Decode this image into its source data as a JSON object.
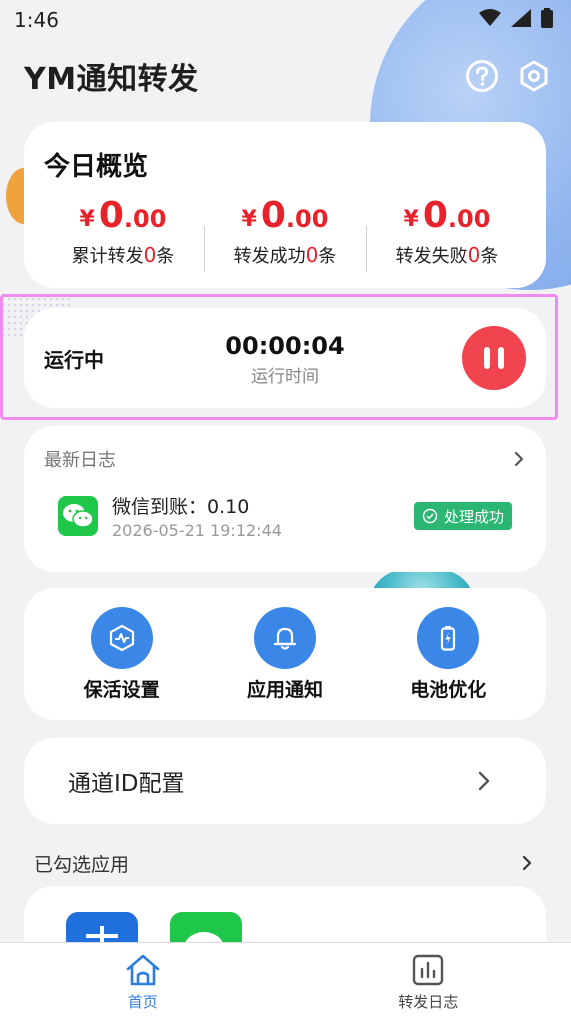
{
  "status_bar": {
    "time": "1:46"
  },
  "app": {
    "title": "YM通知转发"
  },
  "overview": {
    "title": "今日概览",
    "stats": [
      {
        "currency": "¥",
        "amount_int": "0",
        "amount_dec": ".00",
        "label_prefix": "累计转发",
        "count": "0",
        "label_suffix": "条"
      },
      {
        "currency": "¥",
        "amount_int": "0",
        "amount_dec": ".00",
        "label_prefix": "转发成功",
        "count": "0",
        "label_suffix": "条"
      },
      {
        "currency": "¥",
        "amount_int": "0",
        "amount_dec": ".00",
        "label_prefix": "转发失败",
        "count": "0",
        "label_suffix": "条"
      }
    ]
  },
  "run": {
    "status": "运行中",
    "elapsed": "00:00:04",
    "elapsed_label": "运行时间"
  },
  "log": {
    "title": "最新日志",
    "latest": {
      "message": "微信到账：0.10",
      "datetime": "2026-05-21 19:12:44",
      "badge": "处理成功"
    }
  },
  "quick_actions": [
    {
      "label": "保活设置",
      "icon": "shield-pulse-icon"
    },
    {
      "label": "应用通知",
      "icon": "bell-icon"
    },
    {
      "label": "电池优化",
      "icon": "battery-icon"
    }
  ],
  "channel": {
    "label": "通道ID配置"
  },
  "selected_apps": {
    "title": "已勾选应用"
  },
  "bottom_nav": [
    {
      "label": "首页",
      "icon": "home-icon",
      "active": true
    },
    {
      "label": "转发日志",
      "icon": "chart-icon",
      "active": false
    }
  ],
  "colors": {
    "accent_red": "#e8222b",
    "accent_blue": "#3a87e8",
    "success_green": "#2bb673",
    "highlight": "#f08cf0"
  }
}
